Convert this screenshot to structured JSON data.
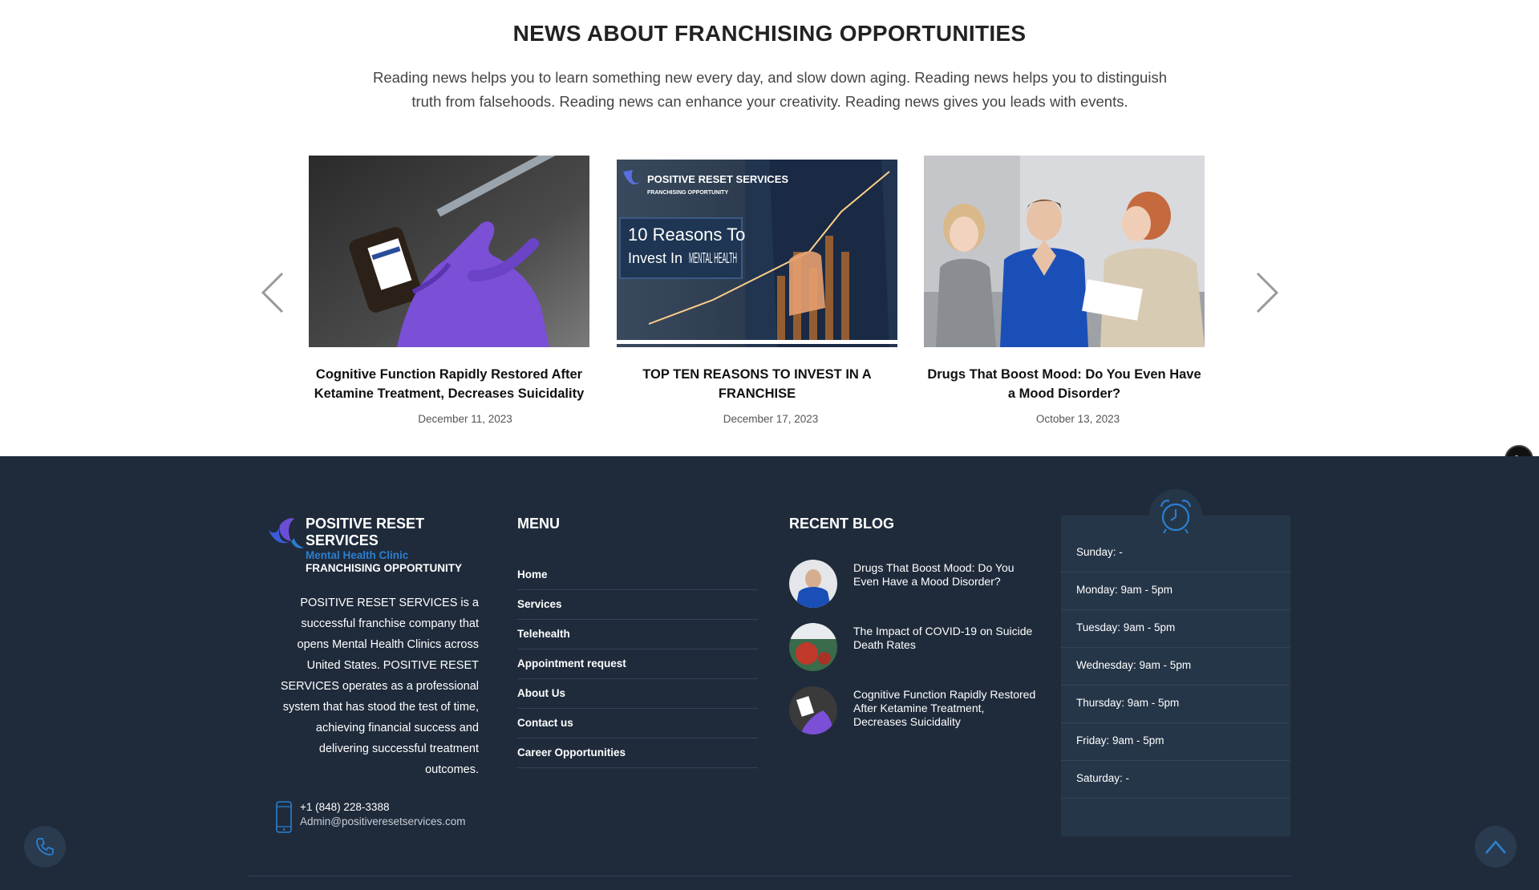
{
  "news": {
    "title": "NEWS ABOUT FRANCHISING OPPORTUNITIES",
    "intro": "Reading news helps you to learn something new every day, and slow down aging. Reading news helps you to distinguish truth from falsehoods. Reading news can enhance your creativity. Reading news gives you leads with events.",
    "prev_icon": "chevron-left-icon",
    "next_icon": "chevron-right-icon",
    "cards": [
      {
        "title": "Cognitive Function Rapidly Restored After Ketamine Treatment, Decreases Suicidality",
        "date": "December 11, 2023"
      },
      {
        "title": "TOP TEN REASONS TO INVEST IN A FRANCHISE",
        "date": "December 17, 2023",
        "image_text": {
          "brand": "POSITIVE RESET SERVICES",
          "tag": "FRANCHISING OPPORTUNITY",
          "headline_1": "10 Reasons To",
          "headline_2_a": "Invest In",
          "headline_2_b": "MENTAL HEALTH"
        }
      },
      {
        "title": "Drugs That Boost Mood: Do You Even Have a Mood Disorder?",
        "date": "October 13, 2023"
      }
    ]
  },
  "footer": {
    "logo": {
      "name": "POSITIVE RESET SERVICES",
      "subtitle": "Mental Health Clinic",
      "tagline": "FRANCHISING OPPORTUNITY"
    },
    "about": "POSITIVE RESET SERVICES is a successful franchise company that opens Mental Health Clinics across United States. POSITIVE RESET SERVICES operates as a professional system that has stood the test of time, achieving financial success and delivering successful treatment outcomes.",
    "contact": {
      "phone": "+1 (848) 228-3388",
      "email": "Admin@positiveresetservices.com"
    },
    "menu": {
      "heading": "MENU",
      "items": [
        "Home",
        "Services",
        "Telehealth",
        "Appointment request",
        "About Us",
        "Contact us",
        "Career Opportunities"
      ]
    },
    "blog": {
      "heading": "RECENT BLOG",
      "items": [
        "Drugs That Boost Mood: Do You Even Have a Mood Disorder?",
        "The Impact of COVID-19 on Suicide Death Rates",
        "Cognitive Function Rapidly Restored After Ketamine Treatment, Decreases Suicidality"
      ]
    },
    "hours": [
      "Sunday: -",
      "Monday: 9am - 5pm",
      "Tuesday: 9am - 5pm",
      "Wednesday: 9am - 5pm",
      "Thursday: 9am - 5pm",
      "Friday: 9am - 5pm",
      "Saturday: -"
    ]
  },
  "colors": {
    "footer_bg": "#1f2b3b",
    "accent": "#2b7fd0",
    "hours_bg": "#263649"
  }
}
